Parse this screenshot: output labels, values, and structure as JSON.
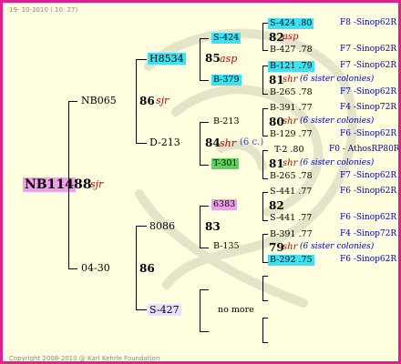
{
  "header": "19- 10-2010 ( 10: 27)",
  "footer": "Copyright 2008-2010 @ Karl Kehrle Foundation",
  "colors": {
    "border": "#e02090",
    "background": "#ffffe0",
    "cyan": "#40e0f0",
    "pink": "#f0a0e8",
    "green": "#60d060",
    "lavender": "#e8e0ff",
    "year": "#c00000",
    "pedi": "#0000c0"
  },
  "root": {
    "id": "NB114",
    "score": "88",
    "year": "sjr"
  },
  "gen1": {
    "top": "NB065",
    "bottom": "04-30"
  },
  "gen1_scores": {
    "top_score": "86",
    "top_year": "sjr",
    "bottom_score": "86"
  },
  "gen2": {
    "a": "H8534",
    "b": "D-213",
    "c": "8086",
    "d": "S-427"
  },
  "gen2_scores": {
    "a_score": "85",
    "a_year": "asp",
    "b_score": "84",
    "b_year": "shr",
    "b_note": "(6 c.)",
    "c_score": "83",
    "d_text": "no more"
  },
  "gen3": {
    "a1": "S-424",
    "a2": "B-379",
    "b1": "B-213",
    "b2": "T-301",
    "c1": "6383",
    "c2": "B-135"
  },
  "gen4": [
    {
      "line1": "S-424 .80",
      "ped1": "F8 -Sinop62R",
      "score": "82",
      "year": "asp",
      "line2": "B-427 .78",
      "ped2": "F7 -Sinop62R"
    },
    {
      "line1": "B-121 .79",
      "ped1": "F7 -Sinop62R",
      "score": "81",
      "year": "shr",
      "note": "(6 sister colonies)",
      "line2": "B-265 .78",
      "ped2": "F7 -Sinop62R"
    },
    {
      "line1": "B-391 .77",
      "ped1": "F4 -Sinop72R",
      "score": "80",
      "year": "shr",
      "note": "(6 sister colonies)",
      "line2": "B-129 .77",
      "ped2": "F6 -Sinop62R"
    },
    {
      "line1": "T-2 .80",
      "ped1": "F0 - AthosRP80R",
      "score": "81",
      "year": "shr",
      "note": "(6 sister colonies)",
      "line2": "B-265 .78",
      "ped2": "F7 -Sinop62R"
    },
    {
      "line1": "S-441 .77",
      "ped1": "F6 -Sinop62R",
      "score": "82",
      "line2": "S-441 .77",
      "ped2": "F6 -Sinop62R"
    },
    {
      "line1": "B-391 .77",
      "ped1": "F4 -Sinop72R",
      "score": "79",
      "year": "shr",
      "note": "(6 sister colonies)",
      "line2": "B-292 .75",
      "ped2": "F6 -Sinop62R"
    }
  ]
}
